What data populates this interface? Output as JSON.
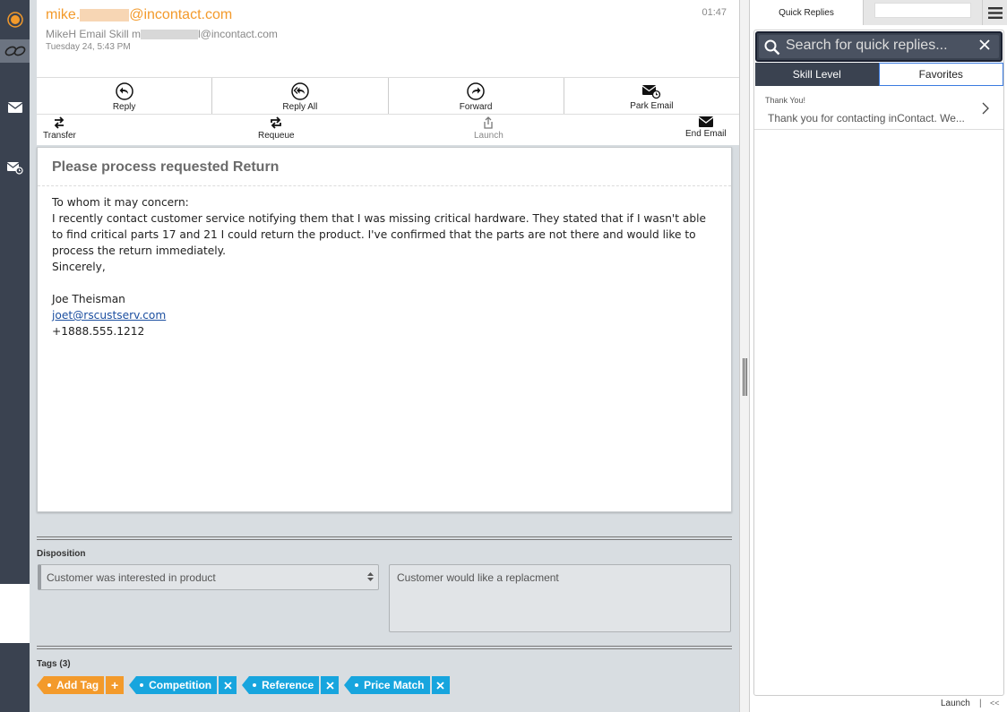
{
  "email": {
    "from_prefix": "mike.",
    "from_suffix": "@incontact.com",
    "skill_prefix": "MikeH Email Skill  m",
    "skill_suffix": "l@incontact.com",
    "date": "Tuesday 24, 5:43 PM",
    "timer": "01:47",
    "subject": "Please process requested Return",
    "body_greeting": "To whom it may concern:",
    "body_paragraph": "I recently contact customer service notifying them that I was missing critical hardware. They stated that if I wasn't able to find critical parts 17 and 21 I could return the product. I've confirmed that the parts are not there and would like to process the return immediately.",
    "body_closing": "Sincerely,",
    "signature_name": "Joe Theisman",
    "signature_email": "joet@rscustserv.com",
    "signature_phone": "+1888.555.1212"
  },
  "toolbar": {
    "reply": "Reply",
    "reply_all": "Reply All",
    "forward": "Forward",
    "park_email": "Park Email",
    "transfer": "Transfer",
    "requeue": "Requeue",
    "launch": "Launch",
    "end_email": "End Email"
  },
  "disposition": {
    "label": "Disposition",
    "selected": "Customer was interested in product",
    "notes": "Customer would like a replacment"
  },
  "tags": {
    "label": "Tags (3)",
    "add_label": "Add Tag",
    "items": [
      "Competition",
      "Reference",
      "Price Match"
    ]
  },
  "quick_replies": {
    "tab_label": "Quick Replies",
    "search_placeholder": "Search for quick replies...",
    "toggle_skill": "Skill Level",
    "toggle_favorites": "Favorites",
    "items": [
      {
        "title": "Thank You!",
        "text": "Thank you for contacting inContact. We..."
      }
    ]
  },
  "footer": {
    "launch": "Launch",
    "separator": "|",
    "collapse": "<<"
  },
  "colors": {
    "accent_orange": "#f39a2b",
    "tag_blue": "#17a5de",
    "rail_dark": "#3a4250"
  }
}
